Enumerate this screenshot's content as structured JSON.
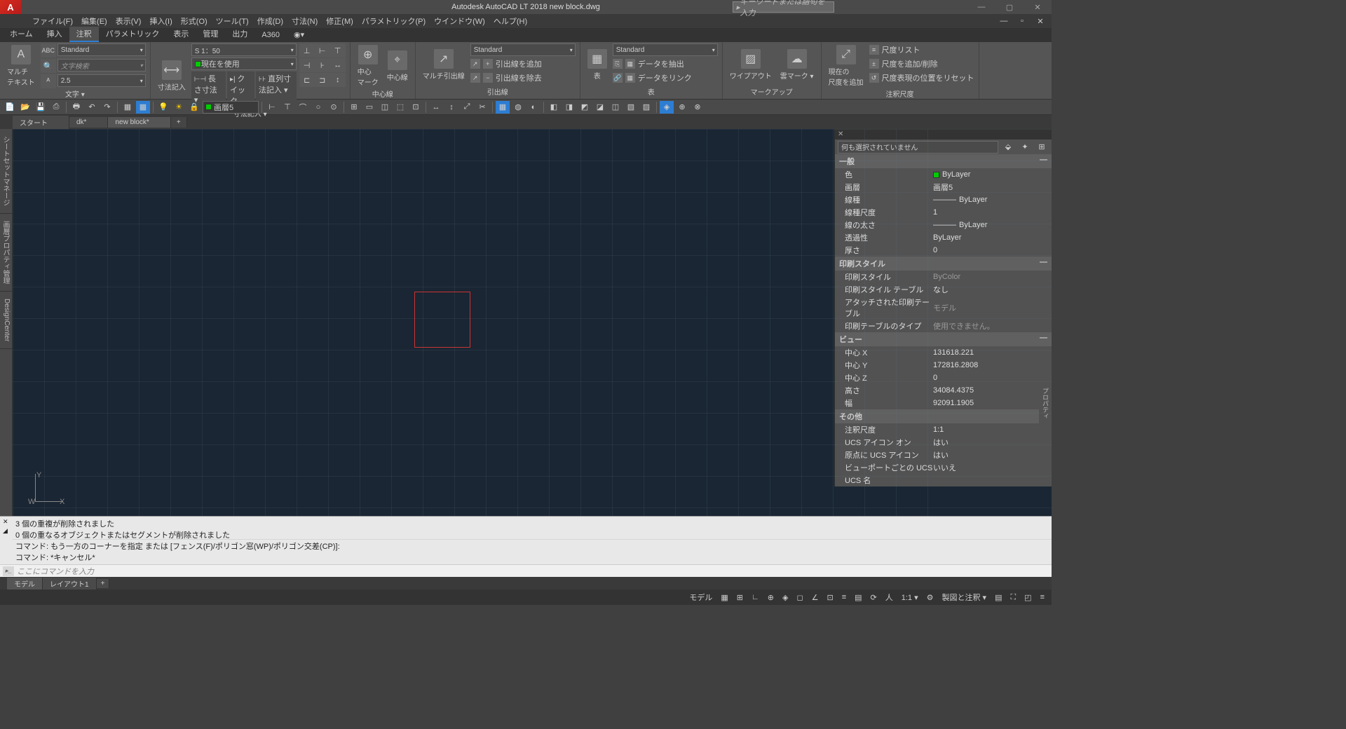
{
  "title_bar": {
    "app_title": "Autodesk AutoCAD LT 2018   new block.dwg",
    "search_placeholder": "キーワードまたは語句を入力"
  },
  "menu": [
    "ファイル(F)",
    "編集(E)",
    "表示(V)",
    "挿入(I)",
    "形式(O)",
    "ツール(T)",
    "作成(D)",
    "寸法(N)",
    "修正(M)",
    "パラメトリック(P)",
    "ウインドウ(W)",
    "ヘルプ(H)"
  ],
  "tabs_main": [
    "ホーム",
    "挿入",
    "注釈",
    "パラメトリック",
    "表示",
    "管理",
    "出力",
    "A360"
  ],
  "tabs_main_active": 2,
  "ribbon": {
    "text_panel": {
      "title": "文字 ▾",
      "big": "マルチ\nテキスト",
      "abc": "ABC",
      "style": "Standard",
      "search": "文字検索",
      "height": "2.5"
    },
    "dim_panel": {
      "title": "寸法記入 ▾",
      "big": "寸法記入",
      "scale": "S 1：50",
      "use_current": "現在を使用",
      "length": "長さ寸法 ▾",
      "quick": "クイック",
      "chain": "直列寸法記入 ▾"
    },
    "center_panel": {
      "title": "中心線",
      "mark": "中心\nマーク",
      "line": "中心線"
    },
    "leader_panel": {
      "title": "引出線",
      "big": "マルチ引出線",
      "style": "Standard",
      "add": "引出線を追加",
      "remove": "引出線を除去"
    },
    "table_panel": {
      "title": "表",
      "big": "表",
      "style": "Standard",
      "extract": "データを抽出",
      "link": "データをリンク"
    },
    "markup_panel": {
      "title": "マークアップ",
      "wipeout": "ワイプアウト",
      "cloud": "雲マーク ▾"
    },
    "annoscale_panel": {
      "title": "注釈尺度",
      "big": "現在の\n尺度を追加",
      "list": "尺度リスト",
      "adddel": "尺度を追加/削除",
      "reset": "尺度表現の位置をリセット"
    }
  },
  "layer_name": "画層5",
  "doc_tabs": [
    "スタート",
    "dk*",
    "new block*"
  ],
  "side_palettes": [
    "シートセットマネージ",
    "画層プロパティ管理",
    "DesignCenter"
  ],
  "properties": {
    "selection": "何も選択されていません",
    "sec_general": "一般",
    "general": {
      "color": "ByLayer",
      "layer": "画層5",
      "linetype": "ByLayer",
      "ltscale": "1",
      "lineweight": "ByLayer",
      "transparency": "ByLayer",
      "thickness": "0"
    },
    "labels_general": {
      "color": "色",
      "layer": "画層",
      "linetype": "線種",
      "ltscale": "線種尺度",
      "lineweight": "線の太さ",
      "transparency": "透過性",
      "thickness": "厚さ"
    },
    "sec_plot": "印刷スタイル",
    "plot": {
      "style": "ByColor",
      "table": "なし",
      "attached": "モデル",
      "type": "使用できません。"
    },
    "labels_plot": {
      "style": "印刷スタイル",
      "table": "印刷スタイル テーブル",
      "attached": "アタッチされた印刷テーブル",
      "type": "印刷テーブルのタイプ"
    },
    "sec_view": "ビュー",
    "view": {
      "cx": "131618.221",
      "cy": "172816.2808",
      "cz": "0",
      "h": "34084.4375",
      "w": "92091.1905"
    },
    "labels_view": {
      "cx": "中心 X",
      "cy": "中心 Y",
      "cz": "中心 Z",
      "h": "高さ",
      "w": "幅"
    },
    "sec_other": "その他",
    "other": {
      "annoscale": "1:1",
      "ucsicon": "はい",
      "ucsorigin": "はい",
      "ucsvp": "いいえ",
      "ucsname": ""
    },
    "labels_other": {
      "annoscale": "注釈尺度",
      "ucsicon": "UCS アイコン オン",
      "ucsorigin": "原点に UCS アイコン",
      "ucsvp": "ビューポートごとの UCS",
      "ucsname": "UCS 名"
    },
    "vtab": "プロパティ"
  },
  "command": {
    "l1": "3 個の重複が削除されました",
    "l2": "0 個の重なるオブジェクトまたはセグメントが削除されました",
    "l3": "コマンド: もう一方のコーナーを指定 または [フェンス(F)/ポリゴン窓(WP)/ポリゴン交差(CP)]:",
    "l4": "コマンド: *キャンセル*",
    "prompt": "ここにコマンドを入力"
  },
  "layout_tabs": [
    "モデル",
    "レイアウト1"
  ],
  "status": {
    "model": "モデル",
    "scale": "1:1 ▾",
    "drawanno": "製図と注釈 ▾"
  },
  "ucs": {
    "y": "Y",
    "x": "X",
    "w": "W"
  }
}
